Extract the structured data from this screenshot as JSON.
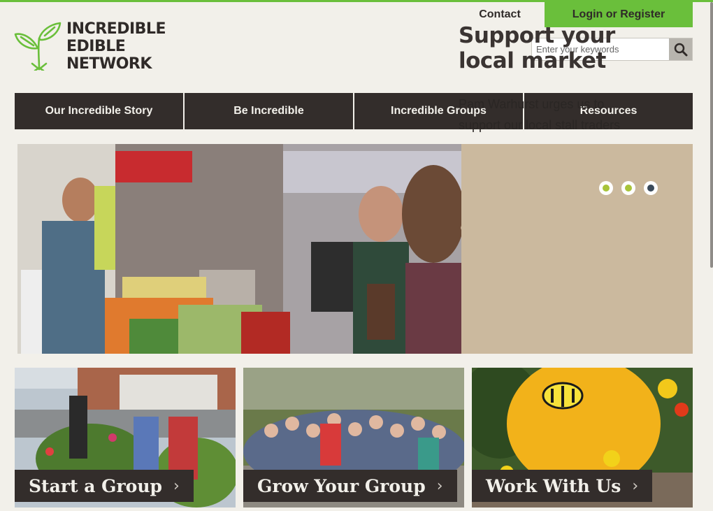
{
  "brand": {
    "logo_lines": [
      "INCREDIBLE",
      "EDIBLE",
      "NETWORK"
    ],
    "accent": "#6abf3b",
    "dark": "#332d2b"
  },
  "header": {
    "contact_label": "Contact",
    "login_label": "Login or Register",
    "search_placeholder": "Enter your keywords",
    "search_icon": "search-icon"
  },
  "nav": {
    "items": [
      "Our Incredible Story",
      "Be Incredible",
      "Incredible Groups",
      "Resources"
    ]
  },
  "hero": {
    "title": "Support your local market",
    "subtitle": "Pam Warhurst urges us to support our local stall traders",
    "slides": [
      {
        "color": "#a8c43a",
        "active": false
      },
      {
        "color": "#a8c43a",
        "active": false
      },
      {
        "color": "#3a4a5a",
        "active": true
      }
    ]
  },
  "cards": [
    {
      "label": "Start a Group"
    },
    {
      "label": "Grow Your Group"
    },
    {
      "label": "Work With Us"
    }
  ],
  "chevron": "›"
}
